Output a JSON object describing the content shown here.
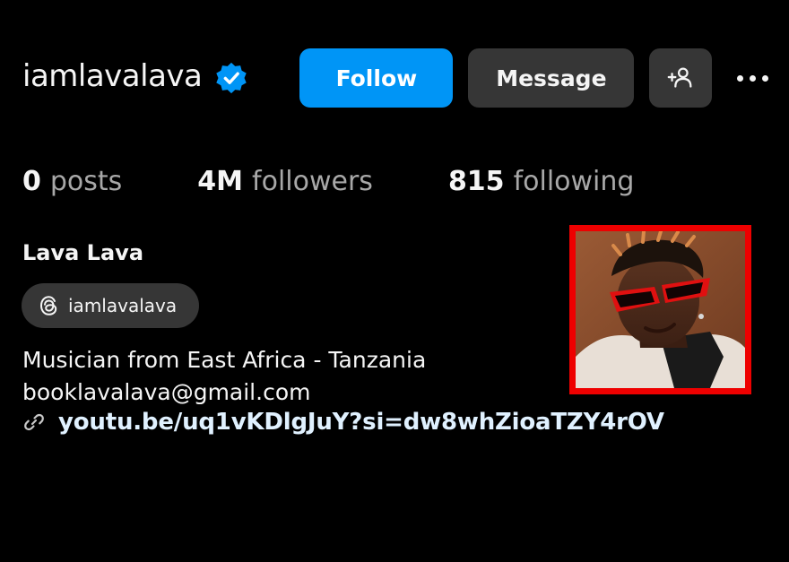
{
  "profile": {
    "username": "iamlavalava",
    "verified": true,
    "accent_color": "#0095f6",
    "full_name": "Lava Lava",
    "threads_handle": "iamlavalava",
    "bio_lines": [
      "Musician from East Africa - Tanzania",
      "booklavalava@gmail.com"
    ],
    "link": "youtu.be/uq1vKDlgJuY?si=dw8whZioaTZY4rOV"
  },
  "actions": {
    "follow_label": "Follow",
    "message_label": "Message",
    "add_user_icon": "add-person-icon",
    "more_icon": "more-options-icon"
  },
  "stats": {
    "posts": {
      "count": "0",
      "label": "posts"
    },
    "followers": {
      "count": "4M",
      "label": "followers"
    },
    "following": {
      "count": "815",
      "label": "following"
    }
  },
  "highlight_color": "#ee0000"
}
